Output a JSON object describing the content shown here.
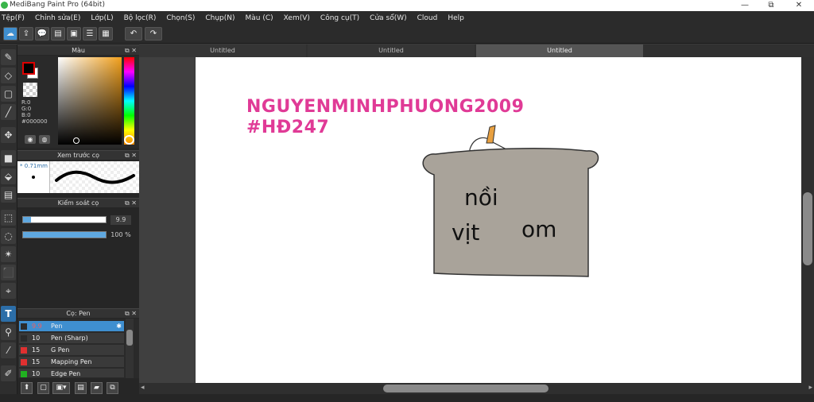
{
  "window": {
    "title": "MediBang Paint Pro (64bit)",
    "minimize": "—",
    "maximize": "⧉",
    "close": "✕"
  },
  "menu": [
    "Tệp(F)",
    "Chỉnh sửa(E)",
    "Lớp(L)",
    "Bộ lọc(R)",
    "Chọn(S)",
    "Chụp(N)",
    "Màu (C)",
    "Xem(V)",
    "Công cụ(T)",
    "Cửa sổ(W)",
    "Cloud",
    "Help"
  ],
  "toolbar": {
    "icons": [
      "☁",
      "⇪",
      "💬",
      "▤",
      "▣",
      "☰",
      "▦"
    ],
    "undo": "↶",
    "redo": "↷"
  },
  "tools": [
    "✎",
    "◇",
    "▢",
    "╱",
    "✥",
    "■",
    "⬙",
    "▤",
    "⬚",
    "◌",
    "✴",
    "⬛",
    "⌖",
    "T",
    "⚲",
    "⁄",
    "✐"
  ],
  "color_panel": {
    "title": "Màu",
    "r": "R:0",
    "g": "G:0",
    "b": "B:0",
    "hex": "#000000",
    "fg_color": "#000000",
    "bg_color": "#ffffff"
  },
  "preview_panel": {
    "title": "Xem trước cọ",
    "size": "0.71mm"
  },
  "control_panel": {
    "title": "Kiểm soát cọ",
    "size_value": "9.9",
    "opacity_value": "100 %",
    "size_fraction": 0.1,
    "opacity_fraction": 1.0
  },
  "brush_panel": {
    "title": "Cọ: Pen",
    "brushes": [
      {
        "size": "9.9",
        "name": "Pen",
        "color": "#2b2b2b"
      },
      {
        "size": "10",
        "name": "Pen (Sharp)",
        "color": "#2b2b2b"
      },
      {
        "size": "15",
        "name": "G Pen",
        "color": "#e03030"
      },
      {
        "size": "15",
        "name": "Mapping Pen",
        "color": "#e03030"
      },
      {
        "size": "10",
        "name": "Edge Pen",
        "color": "#20b020"
      }
    ]
  },
  "bottom_buttons": [
    "⬆",
    "▢",
    "▣▾",
    "▤",
    "▰",
    "⧉"
  ],
  "tabs": [
    "Untitled",
    "Untitled",
    "Untitled"
  ],
  "canvas": {
    "line1": "NGUYENMINHPHUONG2009",
    "line2": "#HĐ247",
    "pot_word1": "nồi",
    "pot_word2": "vịt",
    "pot_word3": "om"
  },
  "panel_icons": {
    "popout": "⧉",
    "close": "✕"
  }
}
